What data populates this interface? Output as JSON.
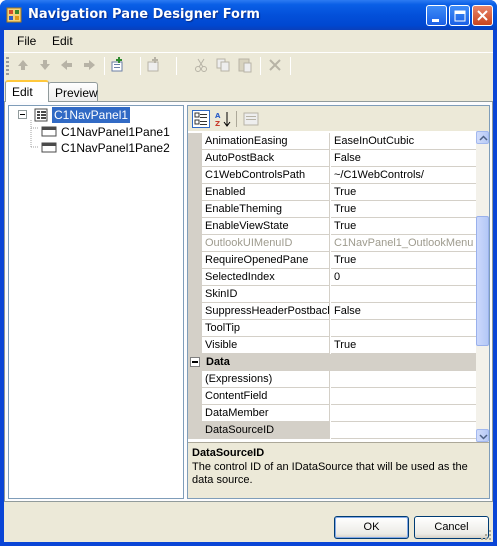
{
  "window": {
    "title": "Navigation Pane Designer Form"
  },
  "menu": {
    "items": [
      {
        "label": "File"
      },
      {
        "label": "Edit"
      }
    ]
  },
  "toolbar": {
    "icons": [
      "move-up-icon",
      "move-down-icon",
      "move-left-icon",
      "move-right-icon",
      "add-item-icon",
      "insert-item-icon",
      "cut-icon",
      "copy-icon",
      "paste-icon",
      "delete-icon"
    ]
  },
  "tabs": [
    {
      "label": "Edit",
      "active": true
    },
    {
      "label": "Preview",
      "active": false
    }
  ],
  "tree": {
    "root": {
      "label": "C1NavPanel1",
      "selected": true
    },
    "children": [
      {
        "label": "C1NavPanel1Pane1"
      },
      {
        "label": "C1NavPanel1Pane2"
      }
    ]
  },
  "properties": {
    "rows": [
      {
        "name": "AnimationEasing",
        "value": "EaseInOutCubic"
      },
      {
        "name": "AutoPostBack",
        "value": "False"
      },
      {
        "name": "C1WebControlsPath",
        "value": "~/C1WebControls/"
      },
      {
        "name": "Enabled",
        "value": "True"
      },
      {
        "name": "EnableTheming",
        "value": "True"
      },
      {
        "name": "EnableViewState",
        "value": "True"
      },
      {
        "name": "OutlookUIMenuID",
        "value": "C1NavPanel1_OutlookMenu",
        "disabled": true
      },
      {
        "name": "RequireOpenedPane",
        "value": "True"
      },
      {
        "name": "SelectedIndex",
        "value": "0"
      },
      {
        "name": "SkinID",
        "value": ""
      },
      {
        "name": "SuppressHeaderPostbacks",
        "value": "False"
      },
      {
        "name": "ToolTip",
        "value": ""
      },
      {
        "name": "Visible",
        "value": "True"
      }
    ],
    "category": "Data",
    "data_rows": [
      {
        "name": "(Expressions)",
        "value": ""
      },
      {
        "name": "ContentField",
        "value": ""
      },
      {
        "name": "DataMember",
        "value": ""
      },
      {
        "name": "DataSourceID",
        "value": "",
        "selected": true
      }
    ]
  },
  "help": {
    "title": "DataSourceID",
    "description": "The control ID of an IDataSource that will be used as the data source."
  },
  "buttons": {
    "ok": "OK",
    "cancel": "Cancel"
  }
}
